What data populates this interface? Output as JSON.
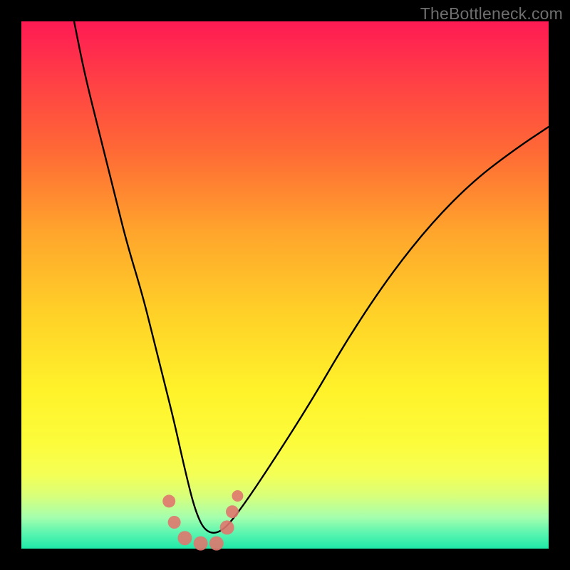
{
  "watermark": "TheBottleneck.com",
  "chart_data": {
    "type": "line",
    "title": "",
    "xlabel": "",
    "ylabel": "",
    "x_range": [
      0,
      100
    ],
    "y_range": [
      0,
      100
    ],
    "series": [
      {
        "name": "bottleneck-curve",
        "color": "#000000",
        "x": [
          10,
          12,
          15,
          18,
          20,
          23,
          25,
          27,
          29,
          31,
          33,
          35,
          38,
          42,
          48,
          55,
          62,
          70,
          78,
          86,
          94,
          100
        ],
        "y": [
          100,
          90,
          78,
          66,
          58,
          48,
          40,
          32,
          24,
          15,
          7,
          3,
          3,
          8,
          17,
          28,
          40,
          52,
          62,
          70,
          76,
          80
        ]
      }
    ],
    "markers": [
      {
        "name": "dot",
        "x": 28,
        "y": 9,
        "r": 9,
        "color": "#e0776e"
      },
      {
        "name": "dot",
        "x": 29,
        "y": 5,
        "r": 9,
        "color": "#e0776e"
      },
      {
        "name": "dot",
        "x": 31,
        "y": 2,
        "r": 10,
        "color": "#e0776e"
      },
      {
        "name": "dot",
        "x": 34,
        "y": 1,
        "r": 10,
        "color": "#e0776e"
      },
      {
        "name": "dot",
        "x": 37,
        "y": 1,
        "r": 10,
        "color": "#e0776e"
      },
      {
        "name": "dot",
        "x": 39,
        "y": 4,
        "r": 10,
        "color": "#e0776e"
      },
      {
        "name": "dot",
        "x": 40,
        "y": 7,
        "r": 9,
        "color": "#e0776e"
      },
      {
        "name": "dot",
        "x": 41,
        "y": 10,
        "r": 8,
        "color": "#e0776e"
      }
    ]
  }
}
